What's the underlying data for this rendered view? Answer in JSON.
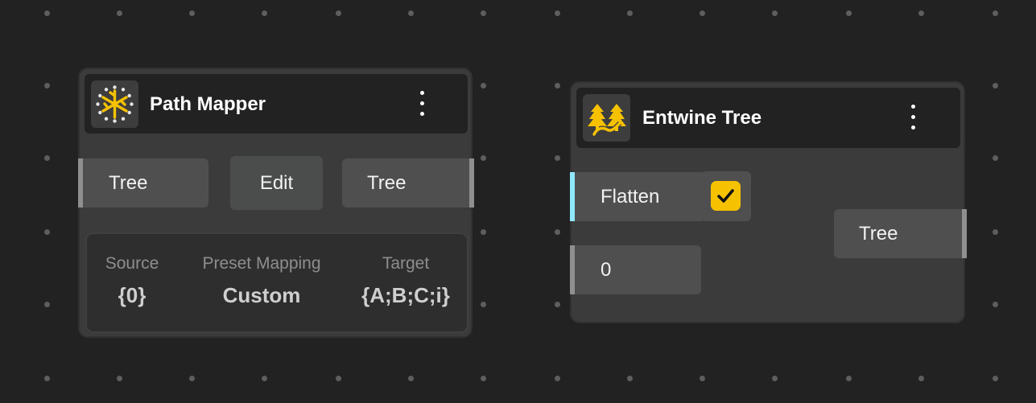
{
  "colors": {
    "canvas": "#222222",
    "node_body": "#3b3b3b",
    "accent_yellow": "#f6c200",
    "accent_cyan": "#8fe8ff",
    "port_bar": "#8f8f8f"
  },
  "path_mapper": {
    "title": "Path Mapper",
    "icon": "path-mapper-icon",
    "input_label": "Tree",
    "edit_label": "Edit",
    "output_label": "Tree",
    "columns": [
      {
        "label": "Source",
        "value": "{0}"
      },
      {
        "label": "Preset Mapping",
        "value": "Custom"
      },
      {
        "label": "Target",
        "value": "{A;B;C;i}"
      }
    ]
  },
  "entwine_tree": {
    "title": "Entwine Tree",
    "icon": "entwine-tree-icon",
    "flatten_label": "Flatten",
    "flatten_checked": true,
    "index_value": "0",
    "output_label": "Tree"
  }
}
